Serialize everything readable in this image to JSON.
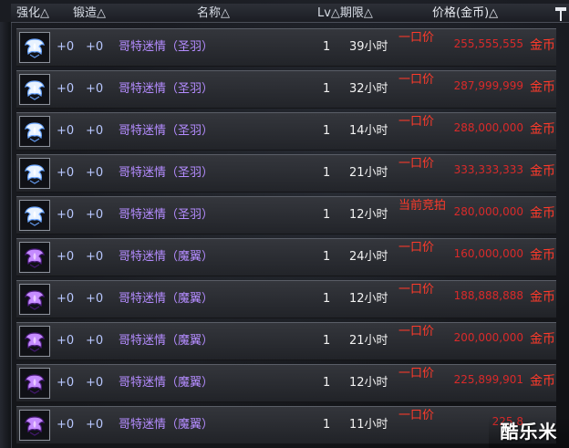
{
  "header": {
    "enhance": "强化△",
    "forge": "锻造△",
    "name": "名称△",
    "lv_expire": "Lv△期限△",
    "price": "价格(金币)△",
    "hammer_icon": "hammer-icon"
  },
  "rows": [
    {
      "icon": "silver-wing-icon",
      "enhance": "+0",
      "forge": "+0",
      "name": "哥特迷情（圣羽）",
      "lv": "1",
      "expire": "39小时",
      "type": "一口价",
      "price": "255,555,555",
      "currency": "金币"
    },
    {
      "icon": "silver-wing-icon",
      "enhance": "+0",
      "forge": "+0",
      "name": "哥特迷情（圣羽）",
      "lv": "1",
      "expire": "32小时",
      "type": "一口价",
      "price": "287,999,999",
      "currency": "金币"
    },
    {
      "icon": "silver-wing-icon",
      "enhance": "+0",
      "forge": "+0",
      "name": "哥特迷情（圣羽）",
      "lv": "1",
      "expire": "14小时",
      "type": "一口价",
      "price": "288,000,000",
      "currency": "金币"
    },
    {
      "icon": "silver-wing-icon",
      "enhance": "+0",
      "forge": "+0",
      "name": "哥特迷情（圣羽）",
      "lv": "1",
      "expire": "21小时",
      "type": "一口价",
      "price": "333,333,333",
      "currency": "金币"
    },
    {
      "icon": "silver-wing-icon",
      "enhance": "+0",
      "forge": "+0",
      "name": "哥特迷情（圣羽）",
      "lv": "1",
      "expire": "12小时",
      "type": "当前竞拍",
      "price": "280,000,000",
      "currency": "金币"
    },
    {
      "icon": "purple-wing-icon",
      "enhance": "+0",
      "forge": "+0",
      "name": "哥特迷情（魔翼）",
      "lv": "1",
      "expire": "24小时",
      "type": "一口价",
      "price": "160,000,000",
      "currency": "金币"
    },
    {
      "icon": "purple-wing-icon",
      "enhance": "+0",
      "forge": "+0",
      "name": "哥特迷情（魔翼）",
      "lv": "1",
      "expire": "12小时",
      "type": "一口价",
      "price": "188,888,888",
      "currency": "金币"
    },
    {
      "icon": "purple-wing-icon",
      "enhance": "+0",
      "forge": "+0",
      "name": "哥特迷情（魔翼）",
      "lv": "1",
      "expire": "21小时",
      "type": "一口价",
      "price": "200,000,000",
      "currency": "金币"
    },
    {
      "icon": "purple-wing-icon",
      "enhance": "+0",
      "forge": "+0",
      "name": "哥特迷情（魔翼）",
      "lv": "1",
      "expire": "12小时",
      "type": "一口价",
      "price": "225,899,901",
      "currency": "金币"
    },
    {
      "icon": "purple-wing-icon",
      "enhance": "+0",
      "forge": "+0",
      "name": "哥特迷情（魔翼）",
      "lv": "1",
      "expire": "11小时",
      "type": "一口价",
      "price": "225,8",
      "currency": ""
    }
  ],
  "watermark": "酷乐米",
  "colors": {
    "name_purple": "#b48cff",
    "plus_blue": "#b8c7ff",
    "price_red": "#d92a2a",
    "type_red": "#ff3a2a"
  }
}
